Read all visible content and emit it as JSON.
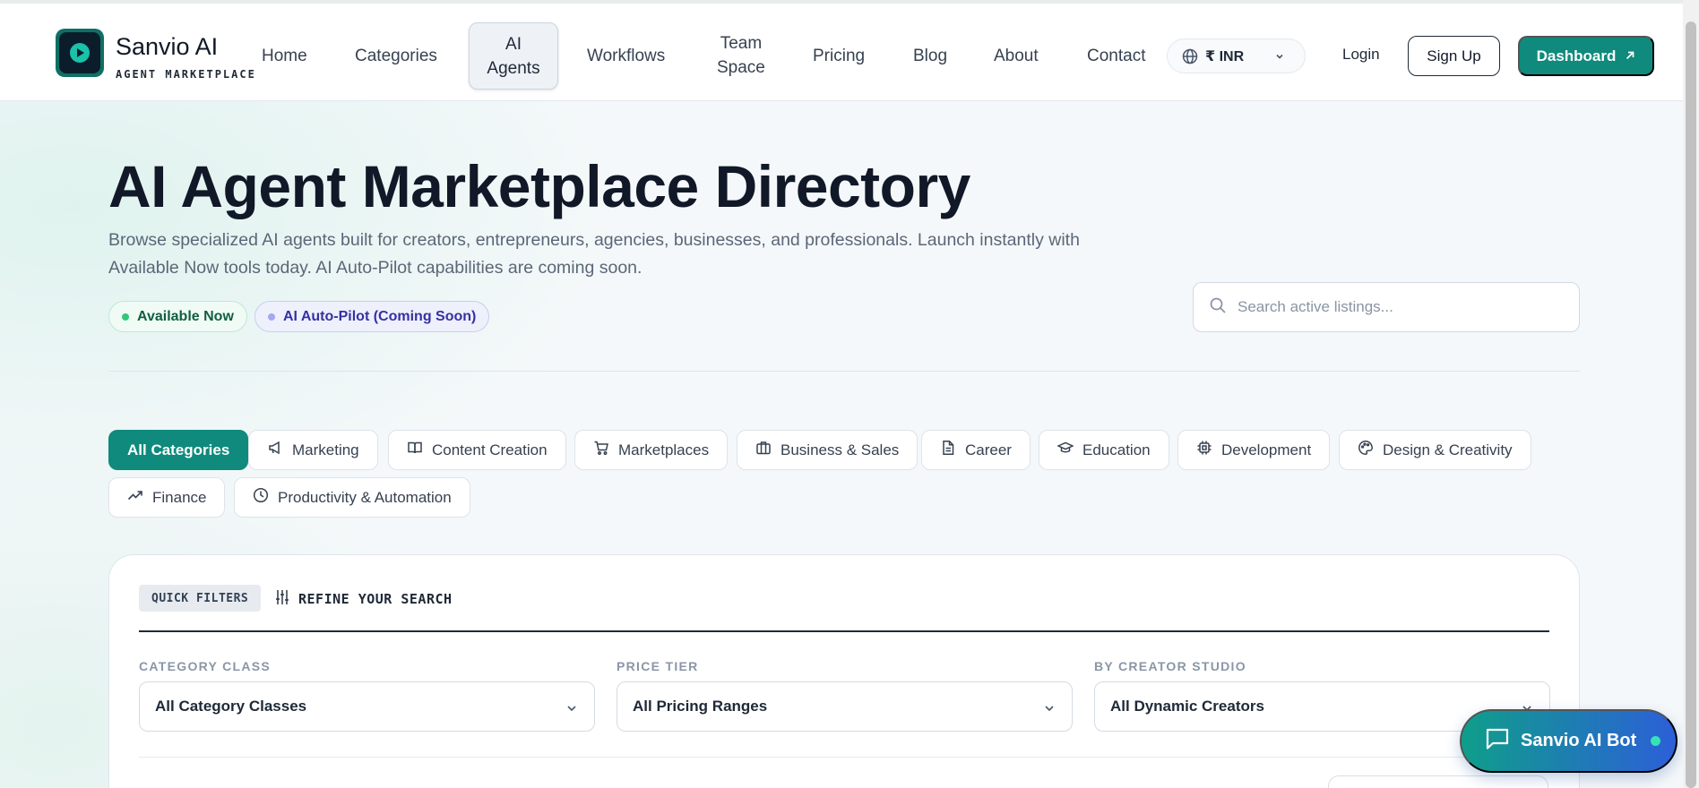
{
  "brand": {
    "name": "Sanvio AI",
    "tagline": "AGENT MARKETPLACE",
    "logo_icon": "sparkle-logo-icon"
  },
  "nav": {
    "items": [
      {
        "label": "Home"
      },
      {
        "label": "Categories"
      },
      {
        "label_line1": "AI",
        "label_line2": "Agents",
        "active": true
      },
      {
        "label": "Workflows"
      },
      {
        "label_line1": "Team",
        "label_line2": "Space"
      },
      {
        "label": "Pricing"
      },
      {
        "label": "Blog"
      },
      {
        "label": "About"
      },
      {
        "label": "Contact"
      }
    ],
    "currency": {
      "label": "₹ INR",
      "icon": "globe-icon"
    },
    "login": "Login",
    "signup": "Sign Up",
    "dashboard": "Dashboard"
  },
  "hero": {
    "title": "AI Agent Marketplace Directory",
    "subtitle_line1": "Browse specialized AI agents built for creators, entrepreneurs, agencies, businesses, and professionals. Launch instantly with",
    "subtitle_line2": "Available Now tools today. AI Auto-Pilot capabilities are coming soon.",
    "badges": [
      {
        "label": "Available Now",
        "color": "#34c77b"
      },
      {
        "label": "AI Auto-Pilot (Coming Soon)",
        "color": "#a5a8f0"
      }
    ],
    "search": {
      "placeholder": "Search active listings...",
      "value": ""
    }
  },
  "categories": [
    {
      "label": "All Categories",
      "active": true,
      "icon": ""
    },
    {
      "label": "Marketing",
      "icon": "megaphone-icon"
    },
    {
      "label": "Content Creation",
      "icon": "book-open-icon"
    },
    {
      "label": "Marketplaces",
      "icon": "cart-icon"
    },
    {
      "label": "Business & Sales",
      "icon": "briefcase-icon"
    },
    {
      "label": "Career",
      "icon": "document-icon"
    },
    {
      "label": "Education",
      "icon": "graduation-cap-icon"
    },
    {
      "label": "Development",
      "icon": "cpu-chip-icon"
    },
    {
      "label": "Design & Creativity",
      "icon": "palette-icon"
    },
    {
      "label": "Finance",
      "icon": "trending-up-icon"
    },
    {
      "label": "Productivity & Automation",
      "icon": "clock-icon"
    }
  ],
  "filters": {
    "badge": "QUICK FILTERS",
    "heading": "REFINE YOUR SEARCH",
    "fields": [
      {
        "label": "CATEGORY CLASS",
        "value": "All Category Classes"
      },
      {
        "label": "PRICE TIER",
        "value": "All Pricing Ranges"
      },
      {
        "label": "BY CREATOR STUDIO",
        "value": "All Dynamic Creators"
      }
    ]
  },
  "chatbot": {
    "label": "Sanvio AI Bot",
    "icon": "chat-bubble-icon",
    "status_color": "#34e3b8"
  },
  "colors": {
    "accent": "#0f8a7c",
    "brand_dark": "#0b1d2a",
    "text": "#111827"
  }
}
